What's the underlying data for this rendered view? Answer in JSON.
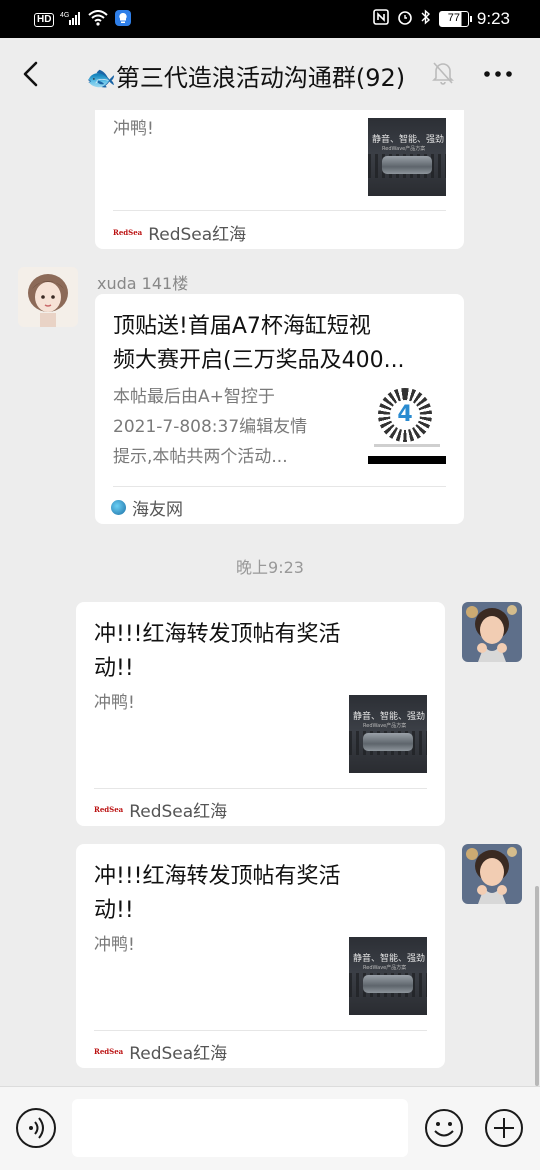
{
  "status_bar": {
    "network": "4G",
    "hd": "HD",
    "battery": "77",
    "time": "9:23"
  },
  "header": {
    "title": "🐟第三代造浪活动沟通群(92)"
  },
  "messages": [
    {
      "card_desc": "冲鸭!",
      "thumb_text": "静音、智能、强劲",
      "thumb_sub": "RedWave产品方案",
      "source": "RedSea红海"
    },
    {
      "sender": "xuda 141楼",
      "card_title_line1": "顶贴送!首届A7杯海缸短视",
      "card_title_line2": "频大赛开启(三万奖品及400...",
      "card_desc_line1": "本帖最后由A+智控于",
      "card_desc_line2": "2021-7-808:37编辑友情",
      "card_desc_line3": "提示,本帖共两个活动...",
      "source": "海友网"
    },
    {
      "timestamp": "晚上9:23"
    },
    {
      "card_title_line1": "冲!!!红海转发顶帖有奖活",
      "card_title_line2": "动!!",
      "card_desc": "冲鸭!",
      "thumb_text": "静音、智能、强劲",
      "thumb_sub": "RedWave产品方案",
      "source": "RedSea红海"
    },
    {
      "card_title_line1": "冲!!!红海转发顶帖有奖活",
      "card_title_line2": "动!!",
      "card_desc": "冲鸭!",
      "thumb_text": "静音、智能、强劲",
      "thumb_sub": "RedWave产品方案",
      "source": "RedSea红海"
    }
  ],
  "logos": {
    "redsea": "RedSea"
  },
  "colors": {
    "background": "#ededed",
    "card": "#ffffff",
    "status_bar": "#000000"
  }
}
